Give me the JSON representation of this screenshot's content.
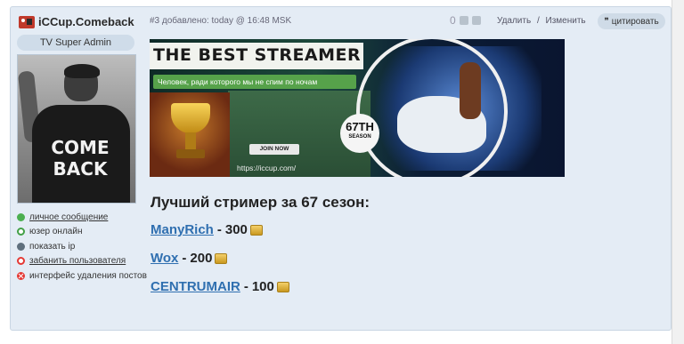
{
  "post": {
    "author": "iCCup.Comeback",
    "user_title": "TV Super Admin",
    "avatar_text": "COME BACK",
    "actions": [
      {
        "label": "личное сообщение",
        "icon": "message-icon",
        "link": true
      },
      {
        "label": "юзер онлайн",
        "icon": "online-status-icon",
        "link": false
      },
      {
        "label": "показать ip",
        "icon": "ip-icon",
        "link": false
      },
      {
        "label": "забанить пользователя",
        "icon": "ban-icon",
        "link": true
      },
      {
        "label": "интерфейс удаления постов",
        "icon": "delete-posts-icon",
        "link": false
      }
    ],
    "meta": "#3 добавлено: today @ 16:48 MSK",
    "rating": "0",
    "delete_label": "Удалить",
    "separator": "/",
    "edit_label": "Изменить",
    "quote_label": "цитировать",
    "quote_icon": "❞",
    "banner": {
      "title": "THE BEST STREAMER",
      "slogan": "Человек, ради которого мы не спим по ночам",
      "join": "JOIN NOW",
      "site": "https://iccup.com/",
      "season_num": "67TH",
      "season_label": "SEASON"
    },
    "heading": "Лучший стример за 67 сезон:",
    "rankings": [
      {
        "name": "ManyRich",
        "score": "300"
      },
      {
        "name": "Wox",
        "score": "200"
      },
      {
        "name": "CENTRUMAIR",
        "score": "100"
      }
    ],
    "dash": "-"
  }
}
